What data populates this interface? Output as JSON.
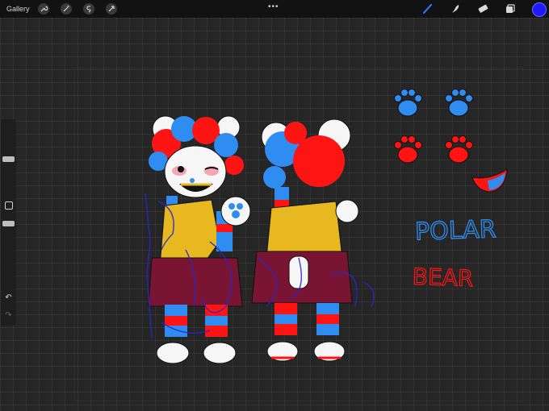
{
  "topbar": {
    "gallery_label": "Gallery",
    "left_tools": [
      "wrench-icon",
      "magic-wand-icon",
      "selection-icon",
      "transform-icon"
    ],
    "right_tools": [
      "brush-icon",
      "smudge-icon",
      "eraser-icon",
      "layers-icon"
    ],
    "active_color": "#1f1aff"
  },
  "sidebar": {
    "controls": [
      "brush-size-slider",
      "modify-button",
      "opacity-slider",
      "undo-button",
      "redo-button"
    ]
  },
  "artwork": {
    "handwritten_text": [
      "POLAR",
      "BEAR"
    ],
    "colors": {
      "red": "#ff1414",
      "blue": "#2f8cf0",
      "yellow": "#e7b81f",
      "maroon": "#7a1433",
      "white": "#f6f6f6",
      "ink": "#2c25c8"
    }
  }
}
